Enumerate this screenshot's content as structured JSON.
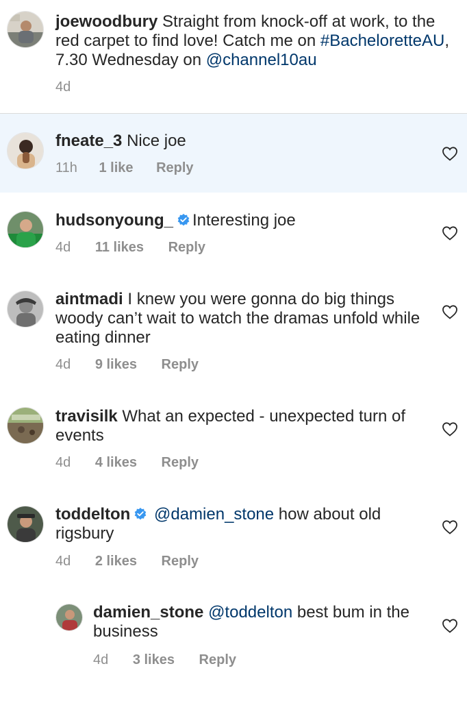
{
  "caption": {
    "username": "joewoodbury",
    "text_before": "Straight from knock-off at work, to the red carpet to find love! Catch me on",
    "hashtag": "#BacheloretteAU",
    "text_middle": ", 7.30 Wednesday on",
    "mention": "@channel10au",
    "time": "4d"
  },
  "comments": [
    {
      "username": "fneate_3",
      "text": "Nice joe",
      "time": "11h",
      "likes": "1 like",
      "reply": "Reply"
    },
    {
      "username": "hudsonyoung_",
      "text": "Interesting joe",
      "time": "4d",
      "likes": "11 likes",
      "reply": "Reply"
    },
    {
      "username": "aintmadi",
      "text": "I knew you were gonna do big things woody can’t wait to watch the dramas unfold while eating dinner",
      "time": "4d",
      "likes": "9 likes",
      "reply": "Reply"
    },
    {
      "username": "travisilk",
      "text": "What an expected - unexpected turn of events",
      "time": "4d",
      "likes": "4 likes",
      "reply": "Reply"
    },
    {
      "username": "toddelton",
      "mention": "@damien_stone",
      "text": "how about old rigsbury",
      "time": "4d",
      "likes": "2 likes",
      "reply": "Reply"
    },
    {
      "username": "damien_stone",
      "mention": "@toddelton",
      "text": "best bum in the business",
      "time": "4d",
      "likes": "3 likes",
      "reply": "Reply"
    }
  ],
  "colors": {
    "text": "#262626",
    "muted": "#8e8e8e",
    "link": "#00376b",
    "verified": "#3897f0",
    "highlight": "#eff6fd"
  }
}
